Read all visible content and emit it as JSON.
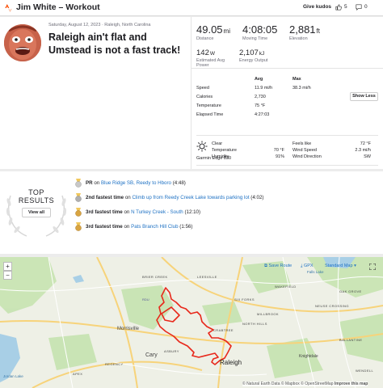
{
  "header": {
    "title": "Jim White – Workout",
    "give_kudos": "Give kudos",
    "kudos_count": "5",
    "comment_count": "0"
  },
  "activity": {
    "date_location": "Saturday, August 12, 2023 · Raleigh, North Carolina",
    "title": "Raleigh ain't flat and Umstead is not a fast track!",
    "stats": {
      "distance": {
        "value": "49.05",
        "unit": "mi",
        "label": "Distance"
      },
      "moving_time": {
        "value": "4:08:05",
        "label": "Moving Time"
      },
      "elevation": {
        "value": "2,881",
        "unit": "ft",
        "label": "Elevation"
      },
      "power": {
        "value": "142",
        "unit": "W",
        "label": "Estimated Avg Power"
      },
      "energy": {
        "value": "2,107",
        "unit": "kJ",
        "label": "Energy Output"
      }
    },
    "details": {
      "avg_header": "Avg",
      "max_header": "Max",
      "show_less": "Show Less",
      "rows": [
        {
          "label": "Speed",
          "avg": "11.9 mi/h",
          "max": "38.3 mi/h"
        },
        {
          "label": "Calories",
          "avg": "2,730",
          "max": ""
        },
        {
          "label": "Temperature",
          "avg": "75 °F",
          "max": ""
        },
        {
          "label": "Elapsed Time",
          "avg": "4:27:03",
          "max": ""
        }
      ]
    },
    "weather": {
      "condition": "Clear",
      "temperature_label": "Temperature",
      "temperature": "70 °F",
      "humidity_label": "Humidity",
      "humidity": "91%",
      "feels_like_label": "Feels like",
      "feels_like": "72 °F",
      "wind_speed_label": "Wind Speed",
      "wind_speed": "2.3 mi/h",
      "wind_direction_label": "Wind Direction",
      "wind_direction": "SW"
    },
    "device": "Garmin Edge 830"
  },
  "results": {
    "heading_top": "TOP",
    "heading_bottom": "RESULTS",
    "view_all": "View all",
    "items": [
      {
        "achievement": "PR",
        "joiner": " on ",
        "segment": "Blue Ridge SB, Reedy to Hboro",
        "time": " (4:48)",
        "medal": "#c8c8c8"
      },
      {
        "achievement": "2nd fastest time",
        "joiner": " on ",
        "segment": "Climb up from Reedy Creek Lake towards parking lot",
        "time": " (4:02)",
        "medal": "#b0b0b0"
      },
      {
        "achievement": "3rd fastest time",
        "joiner": " on ",
        "segment": "N Turkey Creek - South",
        "time": " (12:10)",
        "medal": "#d9a441"
      },
      {
        "achievement": "3rd fastest time",
        "joiner": " on ",
        "segment": "Pats Branch Hill Club",
        "time": " (1:56)",
        "medal": "#d9a441"
      }
    ]
  },
  "map": {
    "zoom_in": "+",
    "zoom_out": "−",
    "save_route": "Save Route",
    "gpx": "GPX",
    "standard_map": "Standard Map",
    "places": {
      "morrisville": "Morrisville",
      "cary": "Cary",
      "raleigh": "Raleigh",
      "knightdale": "Knightdale",
      "millbrook": "MILLBROOK",
      "leesville": "LEESVILLE",
      "brier_creek": "BRIER CREEK",
      "falls_lake": "Falls Lake",
      "apex": "APEX",
      "jordan_lake": "Jordan Lake",
      "rdu": "RDU",
      "asbury": "ASBURY",
      "crabtree": "CRABTREE",
      "north_hills": "NORTH HILLS",
      "oak_grove": "OAK GROVE",
      "neuse_crossing": "NEUSE CROSSING",
      "wakefield": "WAKEFIELD",
      "ballantine": "BALLANTINE",
      "wendell": "WENDELL",
      "regency": "REGENCY",
      "six_forks": "SIX FORKS"
    },
    "attribution_pre": "© Natural Earth Data © Mapbox © OpenStreetMap ",
    "attribution_link": "Improve this map"
  },
  "colors": {
    "brand": "#fc4c02",
    "link": "#1f72c4",
    "route": "#e8281b",
    "park": "#b9dca3"
  }
}
